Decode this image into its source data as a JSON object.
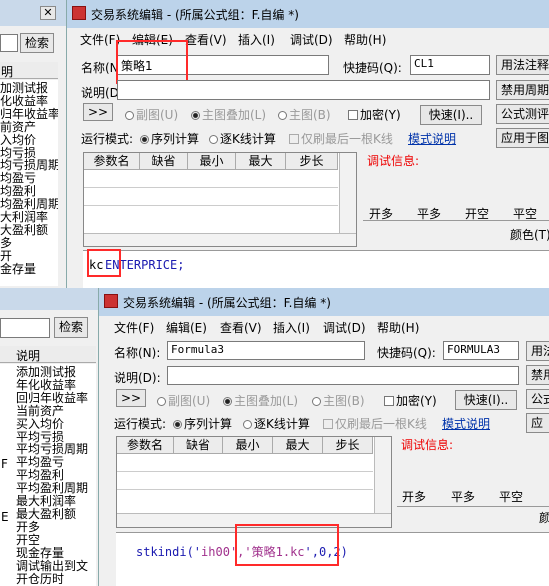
{
  "back_panel_top": {
    "search_button": "检索",
    "header": "明",
    "items": [
      "加测试报",
      "化收益率",
      "归年收益率",
      "前资产",
      "入均价",
      "均亏损",
      "均亏损周期",
      "均盈亏",
      "均盈利",
      "均盈利周期",
      "大利润率",
      "大盈利额",
      "多",
      "开",
      "金存量"
    ]
  },
  "window1": {
    "title": "交易系统编辑 - (所属公式组：F.自编 *)",
    "menu": [
      "文件(F)",
      "编辑(E)",
      "查看(V)",
      "插入(I)",
      "调试(D)",
      "帮助(H)"
    ],
    "name_label": "名称(N):",
    "name_value": "策略1",
    "shortcut_label": "快捷码(Q):",
    "shortcut_value": "CL1",
    "desc_label": "说明(D):",
    "buttons": {
      "usage": "用法注释",
      "disable_period": "禁用周期",
      "test": "公式测评",
      "apply": "应用于图",
      "fast": "快速(I)..",
      "arrow": ">>"
    },
    "options": {
      "sub_chart": "副图(U)",
      "main_overlay": "主图叠加(L)",
      "main_chart": "主图(B)",
      "encrypt": "加密(Y)"
    },
    "run_mode_label": "运行模式:",
    "seq_calc": "序列计算",
    "step_calc": "逐K线计算",
    "last_bar": "仅刷最后一根K线",
    "mode_help": "模式说明",
    "param_headers": [
      "参数名",
      "缺省",
      "最小",
      "最大",
      "步长"
    ],
    "debug_label": "调试信息:",
    "tabs": [
      "开多",
      "平多",
      "开空",
      "平空"
    ],
    "color_label": "颜色(T)",
    "code_keyword": "kc",
    "code_rest": " ENTERPRICE;"
  },
  "window2": {
    "title": "交易系统编辑 - (所属公式组：F.自编 *)",
    "menu": [
      "文件(F)",
      "编辑(E)",
      "查看(V)",
      "插入(I)",
      "调试(D)",
      "帮助(H)"
    ],
    "name_label": "名称(N):",
    "name_value": "Formula3",
    "shortcut_label": "快捷码(Q):",
    "shortcut_value": "FORMULA3",
    "desc_label": "说明(D):",
    "buttons": {
      "usage": "用法",
      "disable": "禁用",
      "test": "公式",
      "apply": "应",
      "fast": "快速(I)..",
      "arrow": ">>"
    },
    "options": {
      "sub_chart": "副图(U)",
      "main_overlay": "主图叠加(L)",
      "main_chart": "主图(B)",
      "encrypt": "加密(Y)"
    },
    "run_mode_label": "运行模式:",
    "seq_calc": "序列计算",
    "step_calc": "逐K线计算",
    "last_bar": "仅刷最后一根K线",
    "mode_help": "模式说明",
    "param_headers": [
      "参数名",
      "缺省",
      "最小",
      "最大",
      "步长"
    ],
    "debug_label": "调试信息:",
    "tabs": [
      "开多",
      "平多",
      "平空"
    ],
    "color_label": "颜",
    "code_prefix": "stkindi('",
    "code_arg1": "ih00",
    "code_sep": "','",
    "code_arg2": "策略1.kc",
    "code_suffix": "',0,2)"
  },
  "back_panel_bottom": {
    "search_button": "检索",
    "header": "说明",
    "items": [
      "添加测试报",
      "年化收益率",
      "回归年收益率",
      "当前资产",
      "买入均价",
      "平均亏损",
      "平均亏损周期",
      "平均盈亏",
      "平均盈利",
      "平均盈利周期",
      "最大利润率",
      "最大盈利额",
      "开多",
      "开空",
      "现金存量",
      "调试输出到文",
      "开仓历时"
    ],
    "letters": [
      "F",
      "E"
    ]
  }
}
